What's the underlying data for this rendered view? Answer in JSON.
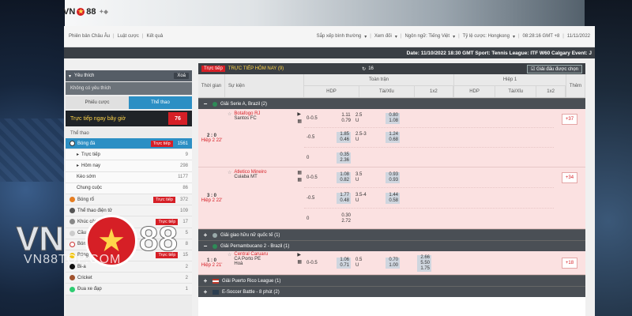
{
  "brand": {
    "name": "VN",
    "num": "88",
    "watermark_vn": "VN",
    "watermark_num": "88",
    "watermark_site": "VN88TOP.COM"
  },
  "topnav": {
    "left": [
      "Phiên bản Châu Âu",
      "Luật cược",
      "Kết quả"
    ],
    "right": [
      "Sắp xếp bình thường",
      "Xem đối",
      "Ngôn ngữ: Tiếng Việt",
      "Tỷ lệ cược: Hongkong",
      "08:28:16 GMT +8",
      "11/11/2022"
    ]
  },
  "ticker": "Date: 11/10/2022 18:30 GMT Sport: Tennis League: ITF W60 Calgary Event: J",
  "sidebar": {
    "favorites": "Yêu thích",
    "clear": "Xoá",
    "no_favorites": "Không có yêu thích",
    "tab_bet": "Phiếu cược",
    "tab_sports": "Thể thao",
    "live_today": "Trực tiếp ngay bây giờ",
    "live_count": "76",
    "section": "Thể thao",
    "items": [
      {
        "label": "Bóng đá",
        "tag": "Trực tiếp",
        "count": "1561"
      },
      {
        "label": "Trực tiếp",
        "count": "9"
      },
      {
        "label": "Hôm nay",
        "count": "298"
      },
      {
        "label": "Kèo sớm",
        "count": "1177"
      },
      {
        "label": "Chung cuộc",
        "count": "86"
      },
      {
        "label": "Bóng rổ",
        "tag": "Trực tiếp",
        "count": "372"
      },
      {
        "label": "Thể thao điện tử",
        "count": "109"
      },
      {
        "label": "Khúc côn cầu",
        "tag": "Trực tiếp",
        "count": "17"
      },
      {
        "label": "Cầu lông",
        "count": "5"
      },
      {
        "label": "Bóng chày",
        "count": "8"
      },
      {
        "label": "Bóng chuyền",
        "tag": "Trực tiếp",
        "count": "15"
      },
      {
        "label": "Bi-a",
        "count": "2"
      },
      {
        "label": "Cricket",
        "count": "2"
      },
      {
        "label": "Đua xe đạp",
        "count": "1"
      }
    ]
  },
  "main": {
    "live_tag": "Trực tiếp",
    "title": "TRỰC TIẾP HÔM NAY (9)",
    "refresh_count": "16",
    "pick": "Giải đấu được chọn",
    "headers": {
      "time": "Thời gian",
      "event": "Sự kiện",
      "full": "Toàn trận",
      "half": "Hiệp 1",
      "hdp": "HDP",
      "ou": "Tài/Xỉu",
      "x12": "1x2",
      "more": "Thêm"
    },
    "leagues": [
      {
        "sign": "−",
        "name": "Giải Serie A, Brazil (2)"
      },
      {
        "sign": "+",
        "name": "Giải giao hữu nữ quốc tế (1)"
      },
      {
        "sign": "−",
        "name": "Giải Pernambucano 2 - Brazil (1)"
      },
      {
        "sign": "+",
        "name": "Giải Puerto Rico League (1)"
      },
      {
        "sign": "+",
        "name": "E-Soccer Battle - 8 phút (2)"
      }
    ],
    "matches": [
      {
        "score": "2 : 0",
        "half": "Hiệp 2 22'",
        "home": "Botafogo RJ",
        "away": "Santos FC",
        "draw": "",
        "more": "+37",
        "rows": [
          {
            "hdp": "0-0.5",
            "hdp_a": "1.11",
            "hdp_b": "0.79",
            "ou": "2.5",
            "ou_u": "U",
            "ou_a": "0.80",
            "ou_b": "1.08"
          },
          {
            "hdp": "-0.5",
            "hdp_a": "1.85",
            "hdp_b": "0.46",
            "ou": "2.5-3",
            "ou_u": "U",
            "ou_a": "1.24",
            "ou_b": "0.68"
          },
          {
            "hdp": "0",
            "hdp_a": "0.35",
            "hdp_b": "2.36",
            "ou": "",
            "ou_u": "",
            "ou_a": "",
            "ou_b": ""
          }
        ]
      },
      {
        "score": "3 : 0",
        "half": "Hiệp 2 22'",
        "home": "Atletico Mineiro",
        "away": "Cuiaba MT",
        "draw": "",
        "more": "+34",
        "rows": [
          {
            "hdp": "0-0.5",
            "hdp_a": "1.08",
            "hdp_b": "0.82",
            "ou": "3.5",
            "ou_u": "U",
            "ou_a": "0.93",
            "ou_b": "0.93"
          },
          {
            "hdp": "-0.5",
            "hdp_a": "1.77",
            "hdp_b": "0.48",
            "ou": "3.5-4",
            "ou_u": "U",
            "ou_a": "1.44",
            "ou_b": "0.58"
          },
          {
            "hdp": "0",
            "hdp_a": "0.30",
            "hdp_b": "2.72",
            "ou": "",
            "ou_u": "",
            "ou_a": "",
            "ou_b": ""
          }
        ]
      },
      {
        "score": "1 : 0",
        "half": "Hiệp 2 21'",
        "home": "Central Caruaru",
        "away": "CA Porto PE",
        "draw": "Hoà",
        "more": "+18",
        "rows": [
          {
            "hdp": "0-0.5",
            "hdp_a": "1.06",
            "hdp_b": "0.71",
            "ou": "0.5",
            "ou_u": "U",
            "ou_a": "0.70",
            "ou_b": "1.00",
            "x1": "2.66",
            "x2": "5.50",
            "x3": "1.75"
          }
        ]
      }
    ]
  },
  "colors": {
    "accent": "#2c8fc4",
    "live": "#d61f26",
    "row_bg": "#fbe1e1",
    "header": "#3b3f44"
  }
}
